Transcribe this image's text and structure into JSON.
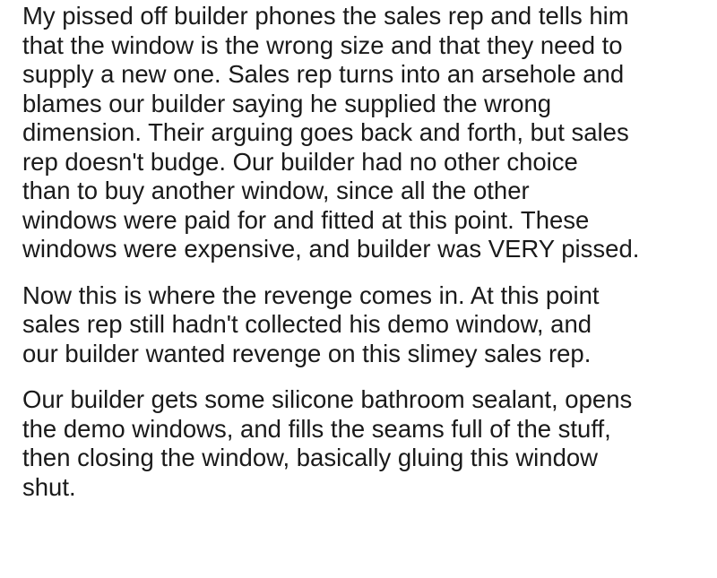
{
  "paragraphs": [
    [
      "My pissed off builder phones the sales rep and tells him",
      "that the window is the wrong size and that they need to",
      "supply a new one. Sales rep turns into an arsehole and",
      "blames our builder saying he supplied the wrong",
      "dimension. Their arguing goes back and forth, but sales",
      "rep doesn't budge. Our builder had no other choice",
      "than to buy another window, since all the other",
      "windows were paid for and fitted at this point. These",
      "windows were expensive, and builder was VERY pissed."
    ],
    [
      "Now this is where the revenge comes in. At this point",
      "sales rep still hadn't collected his demo window, and",
      "our builder wanted revenge on this slimey sales rep."
    ],
    [
      "Our builder gets some silicone bathroom sealant, opens",
      "the demo windows, and fills the seams full of the stuff,",
      "then closing the window, basically gluing this window",
      "shut."
    ]
  ]
}
